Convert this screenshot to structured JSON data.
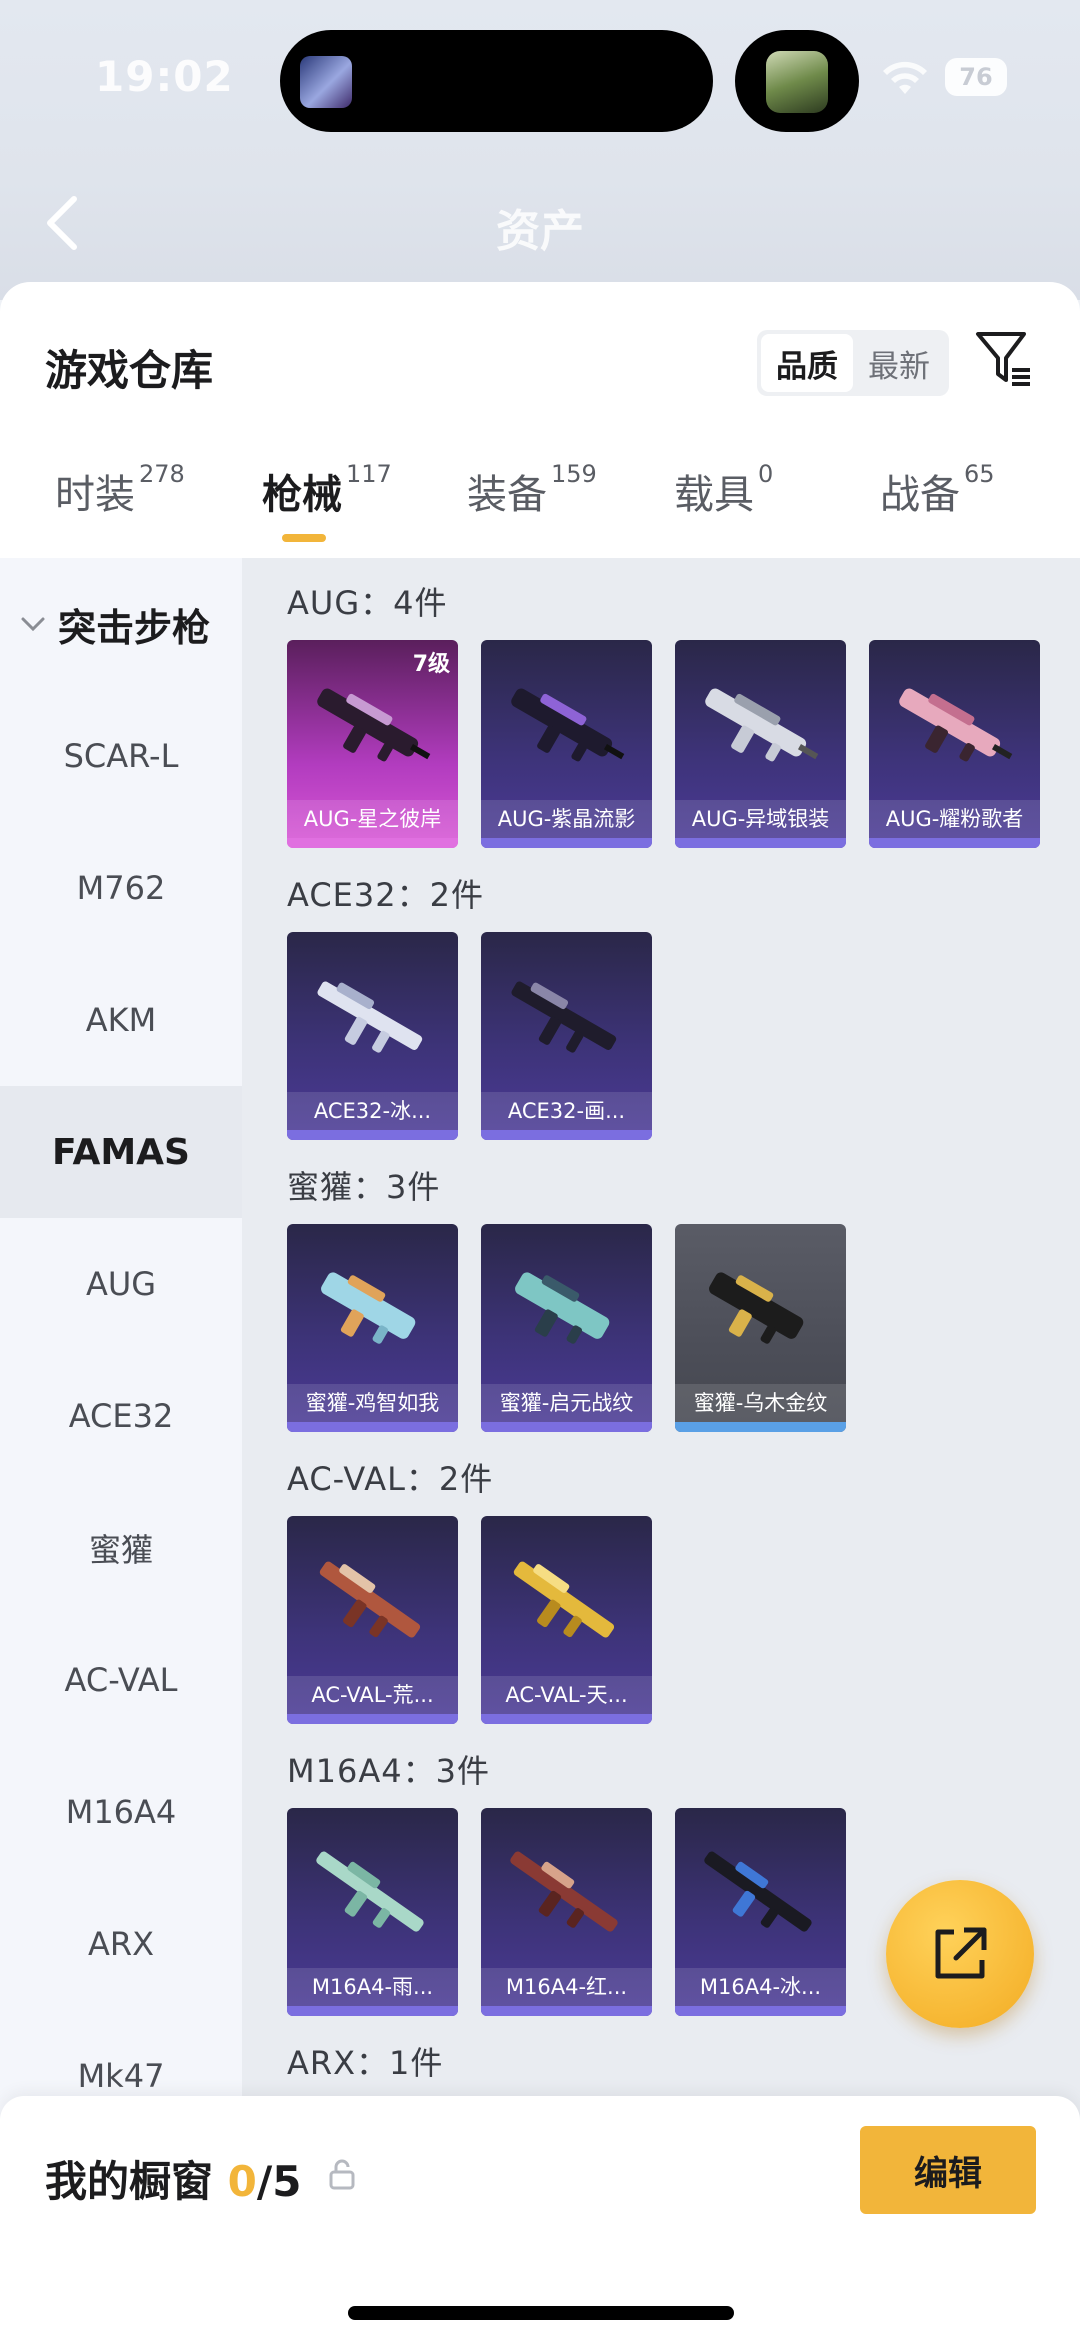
{
  "status": {
    "time": "19:02",
    "battery": "76"
  },
  "header": {
    "title": "资产"
  },
  "warehouse": {
    "title": "游戏仓库",
    "sort": {
      "options": [
        "品质",
        "最新"
      ],
      "active": "品质"
    }
  },
  "tabs": [
    {
      "label": "时装",
      "count": "278",
      "active": false
    },
    {
      "label": "枪械",
      "count": "117",
      "active": true
    },
    {
      "label": "装备",
      "count": "159",
      "active": false
    },
    {
      "label": "载具",
      "count": "0",
      "active": false
    },
    {
      "label": "战备",
      "count": "65",
      "active": false
    }
  ],
  "sidebar": {
    "category": "突击步枪",
    "items": [
      "SCAR-L",
      "M762",
      "AKM",
      "FAMAS",
      "AUG",
      "ACE32",
      "蜜獾",
      "AC-VAL",
      "M16A4",
      "ARX",
      "Mk47"
    ],
    "selected": "FAMAS"
  },
  "groups": [
    {
      "title": "AUG：4件",
      "items": [
        {
          "label": "AUG-星之彼岸",
          "level": "7级",
          "style": "pink"
        },
        {
          "label": "AUG-紫晶流影",
          "style": "blue"
        },
        {
          "label": "AUG-异域银装",
          "style": "blue"
        },
        {
          "label": "AUG-耀粉歌者",
          "style": "blue"
        }
      ]
    },
    {
      "title": "ACE32：2件",
      "items": [
        {
          "label": "ACE32-冰...",
          "style": "blue"
        },
        {
          "label": "ACE32-画...",
          "style": "blue"
        }
      ]
    },
    {
      "title": "蜜獾：3件",
      "items": [
        {
          "label": "蜜獾-鸡智如我",
          "style": "blue"
        },
        {
          "label": "蜜獾-启元战纹",
          "style": "blue"
        },
        {
          "label": "蜜獾-乌木金纹",
          "style": "gold"
        }
      ]
    },
    {
      "title": "AC-VAL：2件",
      "items": [
        {
          "label": "AC-VAL-荒...",
          "style": "blue"
        },
        {
          "label": "AC-VAL-天...",
          "style": "blue"
        }
      ]
    },
    {
      "title": "M16A4：3件",
      "items": [
        {
          "label": "M16A4-雨...",
          "style": "blue"
        },
        {
          "label": "M16A4-红...",
          "style": "blue"
        },
        {
          "label": "M16A4-冰...",
          "style": "blue"
        }
      ]
    },
    {
      "title": "ARX：1件",
      "items": []
    }
  ],
  "showcase": {
    "title": "我的橱窗",
    "count": "0",
    "total": "/5",
    "edit_label": "编辑"
  },
  "colors": {
    "accent": "#f2b53a",
    "card_blue": "#3d3378",
    "card_pink": "#b23cbf",
    "card_gold": "#4c4e58"
  }
}
